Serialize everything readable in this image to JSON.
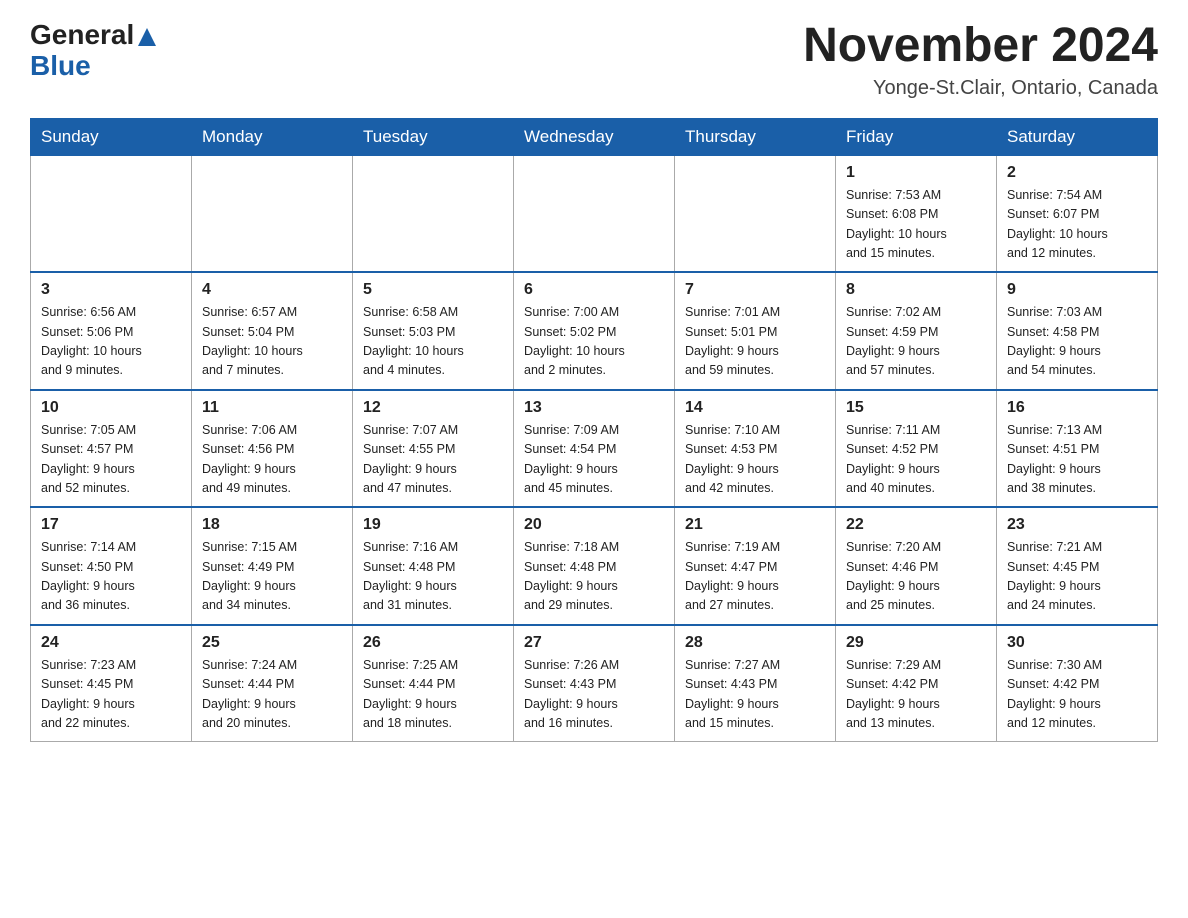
{
  "header": {
    "logo_general": "General",
    "logo_blue": "Blue",
    "month_title": "November 2024",
    "location": "Yonge-St.Clair, Ontario, Canada"
  },
  "weekdays": [
    "Sunday",
    "Monday",
    "Tuesday",
    "Wednesday",
    "Thursday",
    "Friday",
    "Saturday"
  ],
  "weeks": [
    [
      {
        "day": "",
        "info": ""
      },
      {
        "day": "",
        "info": ""
      },
      {
        "day": "",
        "info": ""
      },
      {
        "day": "",
        "info": ""
      },
      {
        "day": "",
        "info": ""
      },
      {
        "day": "1",
        "info": "Sunrise: 7:53 AM\nSunset: 6:08 PM\nDaylight: 10 hours\nand 15 minutes."
      },
      {
        "day": "2",
        "info": "Sunrise: 7:54 AM\nSunset: 6:07 PM\nDaylight: 10 hours\nand 12 minutes."
      }
    ],
    [
      {
        "day": "3",
        "info": "Sunrise: 6:56 AM\nSunset: 5:06 PM\nDaylight: 10 hours\nand 9 minutes."
      },
      {
        "day": "4",
        "info": "Sunrise: 6:57 AM\nSunset: 5:04 PM\nDaylight: 10 hours\nand 7 minutes."
      },
      {
        "day": "5",
        "info": "Sunrise: 6:58 AM\nSunset: 5:03 PM\nDaylight: 10 hours\nand 4 minutes."
      },
      {
        "day": "6",
        "info": "Sunrise: 7:00 AM\nSunset: 5:02 PM\nDaylight: 10 hours\nand 2 minutes."
      },
      {
        "day": "7",
        "info": "Sunrise: 7:01 AM\nSunset: 5:01 PM\nDaylight: 9 hours\nand 59 minutes."
      },
      {
        "day": "8",
        "info": "Sunrise: 7:02 AM\nSunset: 4:59 PM\nDaylight: 9 hours\nand 57 minutes."
      },
      {
        "day": "9",
        "info": "Sunrise: 7:03 AM\nSunset: 4:58 PM\nDaylight: 9 hours\nand 54 minutes."
      }
    ],
    [
      {
        "day": "10",
        "info": "Sunrise: 7:05 AM\nSunset: 4:57 PM\nDaylight: 9 hours\nand 52 minutes."
      },
      {
        "day": "11",
        "info": "Sunrise: 7:06 AM\nSunset: 4:56 PM\nDaylight: 9 hours\nand 49 minutes."
      },
      {
        "day": "12",
        "info": "Sunrise: 7:07 AM\nSunset: 4:55 PM\nDaylight: 9 hours\nand 47 minutes."
      },
      {
        "day": "13",
        "info": "Sunrise: 7:09 AM\nSunset: 4:54 PM\nDaylight: 9 hours\nand 45 minutes."
      },
      {
        "day": "14",
        "info": "Sunrise: 7:10 AM\nSunset: 4:53 PM\nDaylight: 9 hours\nand 42 minutes."
      },
      {
        "day": "15",
        "info": "Sunrise: 7:11 AM\nSunset: 4:52 PM\nDaylight: 9 hours\nand 40 minutes."
      },
      {
        "day": "16",
        "info": "Sunrise: 7:13 AM\nSunset: 4:51 PM\nDaylight: 9 hours\nand 38 minutes."
      }
    ],
    [
      {
        "day": "17",
        "info": "Sunrise: 7:14 AM\nSunset: 4:50 PM\nDaylight: 9 hours\nand 36 minutes."
      },
      {
        "day": "18",
        "info": "Sunrise: 7:15 AM\nSunset: 4:49 PM\nDaylight: 9 hours\nand 34 minutes."
      },
      {
        "day": "19",
        "info": "Sunrise: 7:16 AM\nSunset: 4:48 PM\nDaylight: 9 hours\nand 31 minutes."
      },
      {
        "day": "20",
        "info": "Sunrise: 7:18 AM\nSunset: 4:48 PM\nDaylight: 9 hours\nand 29 minutes."
      },
      {
        "day": "21",
        "info": "Sunrise: 7:19 AM\nSunset: 4:47 PM\nDaylight: 9 hours\nand 27 minutes."
      },
      {
        "day": "22",
        "info": "Sunrise: 7:20 AM\nSunset: 4:46 PM\nDaylight: 9 hours\nand 25 minutes."
      },
      {
        "day": "23",
        "info": "Sunrise: 7:21 AM\nSunset: 4:45 PM\nDaylight: 9 hours\nand 24 minutes."
      }
    ],
    [
      {
        "day": "24",
        "info": "Sunrise: 7:23 AM\nSunset: 4:45 PM\nDaylight: 9 hours\nand 22 minutes."
      },
      {
        "day": "25",
        "info": "Sunrise: 7:24 AM\nSunset: 4:44 PM\nDaylight: 9 hours\nand 20 minutes."
      },
      {
        "day": "26",
        "info": "Sunrise: 7:25 AM\nSunset: 4:44 PM\nDaylight: 9 hours\nand 18 minutes."
      },
      {
        "day": "27",
        "info": "Sunrise: 7:26 AM\nSunset: 4:43 PM\nDaylight: 9 hours\nand 16 minutes."
      },
      {
        "day": "28",
        "info": "Sunrise: 7:27 AM\nSunset: 4:43 PM\nDaylight: 9 hours\nand 15 minutes."
      },
      {
        "day": "29",
        "info": "Sunrise: 7:29 AM\nSunset: 4:42 PM\nDaylight: 9 hours\nand 13 minutes."
      },
      {
        "day": "30",
        "info": "Sunrise: 7:30 AM\nSunset: 4:42 PM\nDaylight: 9 hours\nand 12 minutes."
      }
    ]
  ]
}
